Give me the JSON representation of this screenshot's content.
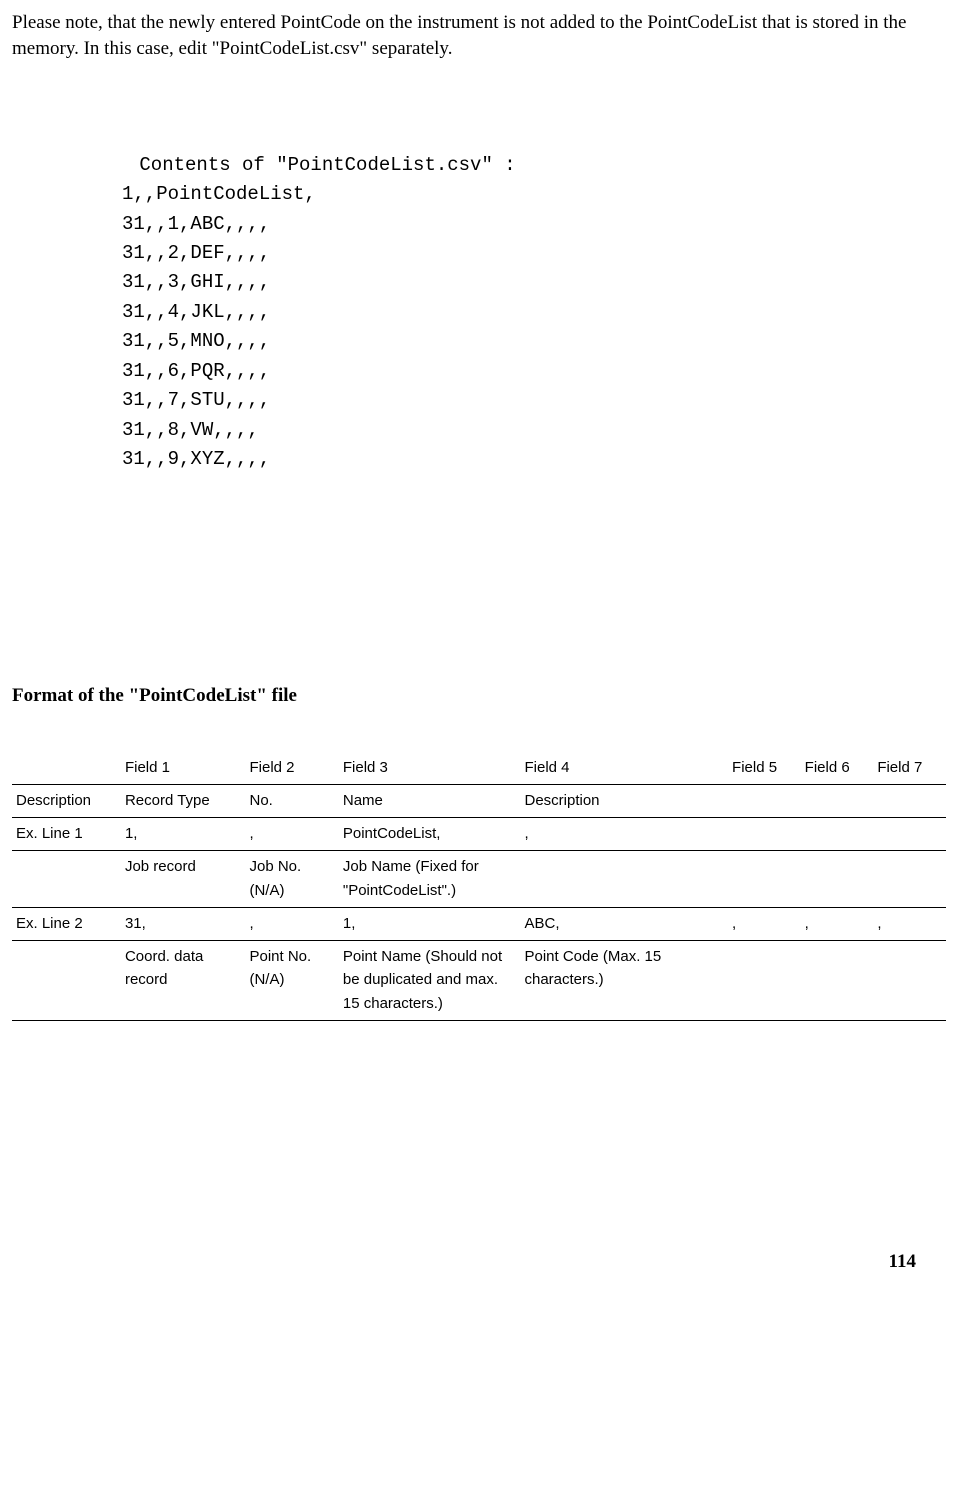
{
  "intro": {
    "p1": "Please note, that the newly entered PointCode on the instrument is not added to the PointCodeList that is stored in the memory. In this case, edit \"PointCodeList.csv\" separately."
  },
  "csv": {
    "title": " Contents of \"PointCodeList.csv\" :",
    "lines": [
      "1,,PointCodeList,",
      "31,,1,ABC,,,,",
      "31,,2,DEF,,,,",
      "31,,3,GHI,,,,",
      "31,,4,JKL,,,,",
      "31,,5,MNO,,,,",
      "31,,6,PQR,,,,",
      "31,,7,STU,,,,",
      "31,,8,VW,,,,",
      "31,,9,XYZ,,,,"
    ]
  },
  "section_title": "Format of the \"PointCodeList\" file",
  "table": {
    "rows": [
      {
        "c0": "",
        "c1": "Field 1",
        "c2": "Field 2",
        "c3": "Field 3",
        "c4": "Field 4",
        "c5": "Field 5",
        "c6": "Field 6",
        "c7": "Field 7"
      },
      {
        "c0": "Description",
        "c1": "Record Type",
        "c2": "No.",
        "c3": "Name",
        "c4": "Description",
        "c5": "",
        "c6": "",
        "c7": ""
      },
      {
        "c0": "Ex. Line 1",
        "c1": "1,",
        "c2": ",",
        "c3": "PointCodeList,",
        "c4": ",",
        "c5": "",
        "c6": "",
        "c7": ""
      },
      {
        "c0": "",
        "c1": "Job record",
        "c2": "Job No. (N/A)",
        "c3": " Job Name (Fixed for \"PointCodeList\".)",
        "c4": "",
        "c5": "",
        "c6": "",
        "c7": ""
      },
      {
        "c0": "Ex. Line 2",
        "c1": "31,",
        "c2": ",",
        "c3": "1,",
        "c4": "ABC,",
        "c5": ",",
        "c6": ",",
        "c7": ","
      },
      {
        "c0": "",
        "c1": "Coord. data record",
        "c2": "Point No. (N/A)",
        "c3": "Point Name (Should not be duplicated and max. 15 characters.)",
        "c4": "Point Code (Max. 15 characters.)",
        "c5": "",
        "c6": "",
        "c7": ""
      }
    ]
  },
  "page_number": "114"
}
